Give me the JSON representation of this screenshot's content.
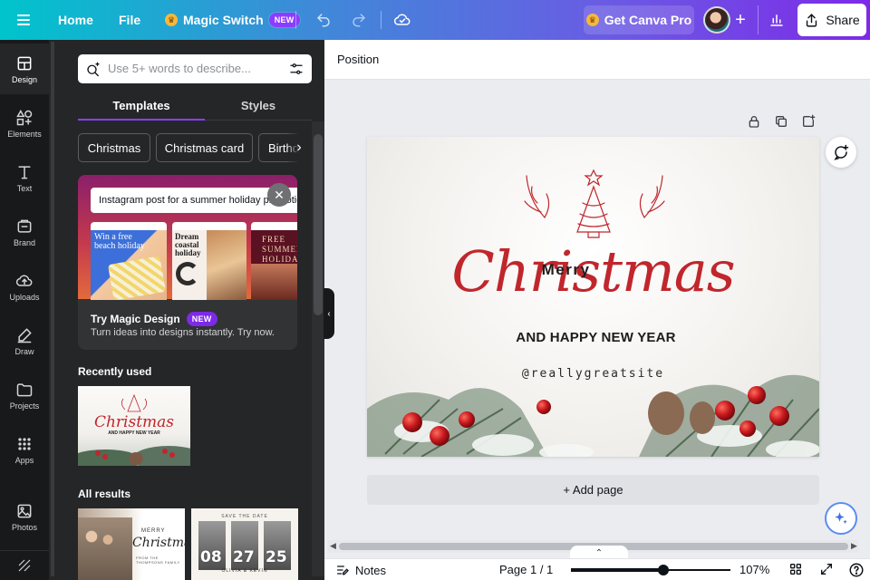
{
  "topbar": {
    "home": "Home",
    "file": "File",
    "magic_switch": "Magic Switch",
    "new_badge": "NEW",
    "get_pro": "Get Canva Pro",
    "share": "Share"
  },
  "rail": {
    "items": [
      {
        "label": "Design",
        "icon": "layout-icon"
      },
      {
        "label": "Elements",
        "icon": "shapes-icon"
      },
      {
        "label": "Text",
        "icon": "text-icon"
      },
      {
        "label": "Brand",
        "icon": "brand-icon"
      },
      {
        "label": "Uploads",
        "icon": "cloud-upload-icon"
      },
      {
        "label": "Draw",
        "icon": "pen-icon"
      },
      {
        "label": "Projects",
        "icon": "folder-icon"
      },
      {
        "label": "Apps",
        "icon": "apps-grid-icon"
      },
      {
        "label": "Photos",
        "icon": "image-icon"
      }
    ]
  },
  "panel": {
    "search_placeholder": "Use 5+ words to describe...",
    "tabs": [
      "Templates",
      "Styles"
    ],
    "chips": [
      "Christmas",
      "Christmas card",
      "Birthday"
    ],
    "magic": {
      "prompt": "Instagram post for a summer holiday promotion",
      "mini1": "Win a free beach holiday",
      "mini2": "Dream coastal holiday",
      "mini3": "FREE SUMMER HOLIDAY",
      "title": "Try Magic Design",
      "badge": "NEW",
      "subtitle": "Turn ideas into designs instantly. Try now."
    },
    "recently_used": "Recently used",
    "all_results": "All results",
    "result1": {
      "small": "MERRY",
      "script": "Christmas!",
      "footer": "FROM THE THOMPSONS FAMILY"
    },
    "result2": {
      "top": "SAVE THE DATE",
      "d1": "08",
      "d2": "27",
      "d3": "25",
      "names": "OLIVIA & KEVIN"
    }
  },
  "context": {
    "position": "Position"
  },
  "design": {
    "merry": "Merry",
    "christmas": "Christmas",
    "happy": "AND HAPPY NEW YEAR",
    "site": "@reallygreatsite"
  },
  "canvas": {
    "add_page": "+ Add page"
  },
  "footer": {
    "notes": "Notes",
    "page": "Page 1 / 1",
    "zoom": "107%",
    "zoom_level": 0.58
  },
  "colors": {
    "brand_purple": "#8b3dff",
    "christmas_red": "#c0262c",
    "rail_bg": "#18191b",
    "panel_bg": "#252627"
  }
}
